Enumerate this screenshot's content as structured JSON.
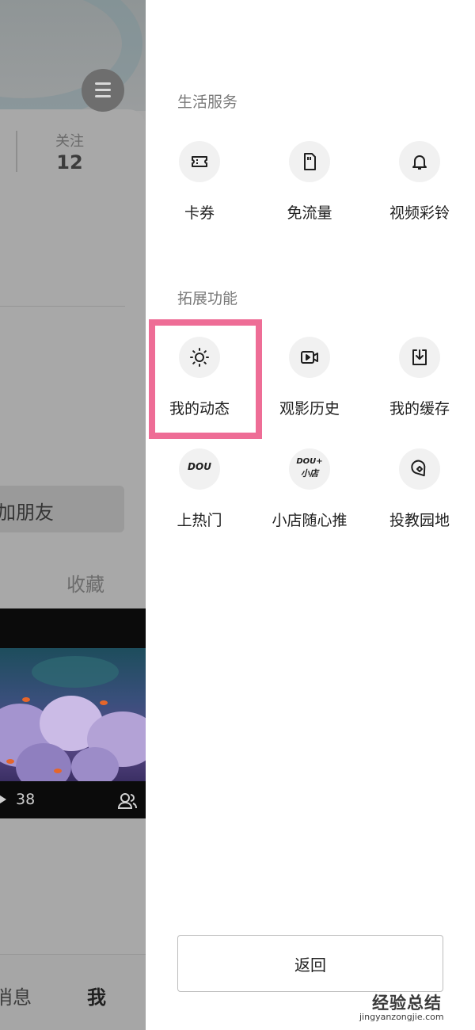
{
  "profile": {
    "stat_following_label": "关注",
    "stat_following_value": "12",
    "add_friend_label": "加朋友",
    "tab_favorites": "收藏",
    "video_views": "38",
    "nav_messages": "消息",
    "nav_me": "我"
  },
  "drawer": {
    "life_services": {
      "title": "生活服务",
      "items": [
        {
          "label": "卡券",
          "icon": "ticket-icon"
        },
        {
          "label": "免流量",
          "icon": "sim-card-icon"
        },
        {
          "label": "视频彩铃",
          "icon": "bell-icon"
        }
      ]
    },
    "extended": {
      "title": "拓展功能",
      "items": [
        {
          "label": "我的动态",
          "icon": "sun-icon",
          "highlighted": true
        },
        {
          "label": "观影历史",
          "icon": "video-camera-icon"
        },
        {
          "label": "我的缓存",
          "icon": "download-icon"
        },
        {
          "label": "上热门",
          "icon": "dou-plus-icon",
          "icon_text": "DOU"
        },
        {
          "label": "小店随心推",
          "icon": "dou-plus-shop-icon",
          "icon_text": [
            "DOU+",
            "小店"
          ]
        },
        {
          "label": "投教园地",
          "icon": "location-pin-icon"
        }
      ]
    },
    "back_label": "返回"
  },
  "watermark": {
    "main": "经验总结",
    "sub": "jingyanzongjie.com"
  },
  "colors": {
    "highlight_border": "#ee6d96",
    "overlay_dim": "#a6a6a6",
    "icon_circle": "#f1f1f1"
  }
}
